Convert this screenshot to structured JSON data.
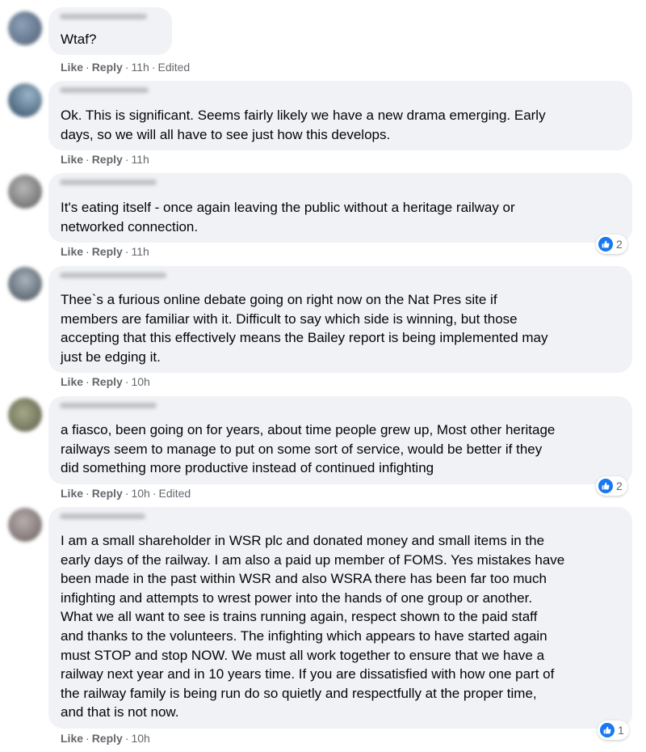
{
  "colors": {
    "bubble_bg": "#f0f2f5",
    "meta_text": "#65676b",
    "like_blue": "#1877f2"
  },
  "actions": {
    "like": "Like",
    "reply": "Reply",
    "separator": "·"
  },
  "comments": [
    {
      "text": "Wtaf?",
      "time": "11h",
      "edited": "Edited"
    },
    {
      "text": "Ok. This is significant. Seems fairly likely we have a new drama emerging. Early\ndays, so we will all have to see just how this develops.",
      "time": "11h"
    },
    {
      "text": "It's eating itself - once again leaving the public without a heritage railway or\nnetworked connection.",
      "time": "11h",
      "reactions": "2"
    },
    {
      "text": "Thee`s a furious online debate going on right now on the Nat Pres site if\nmembers are familiar with it. Difficult to say which side is winning, but those\naccepting that this effectively means the Bailey report is being implemented may\njust be edging it.",
      "time": "10h"
    },
    {
      "text": "a fiasco, been going on for years, about time people grew up, Most other heritage\nrailways seem to manage to put on some sort of service, would be better if they\ndid something more productive instead of continued infighting",
      "time": "10h",
      "edited": "Edited",
      "reactions": "2"
    },
    {
      "text": "I am a small shareholder in WSR plc and donated money and small items in the\nearly days of the railway. I am also a paid up member of FOMS. Yes mistakes have\nbeen made in the past within WSR and also WSRA there has been far too much\ninfighting and attempts to wrest power into the hands of one group or another.\nWhat we all want to see is trains running again, respect shown to the paid staff\nand thanks to the volunteers. The infighting which appears to have started again\nmust STOP and stop NOW. We must all work together to ensure that we have a\nrailway next year and in 10 years time. If you are dissatisfied with how one part of\nthe railway family is being run do so quietly and respectfully at the proper time,\nand that is not now.",
      "time": "10h",
      "reactions": "1"
    }
  ]
}
